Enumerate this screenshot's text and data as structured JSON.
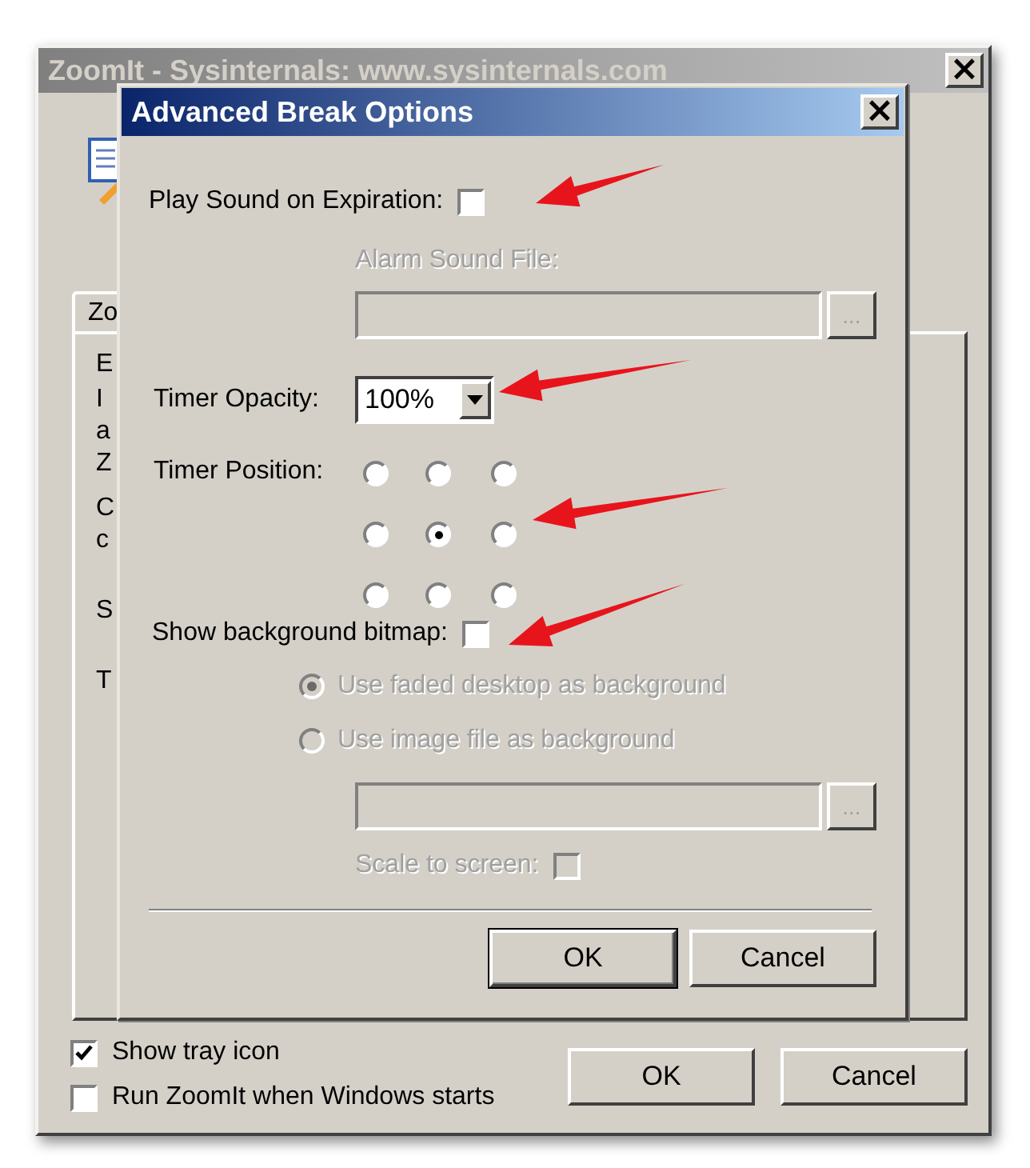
{
  "main_window": {
    "title": "ZoomIt - Sysinternals: www.sysinternals.com",
    "active": false,
    "close": "×",
    "tab": {
      "label": "Zo"
    },
    "hidden_text_fragments": [
      "E",
      "I",
      "a",
      "Z",
      "C",
      "c",
      "S",
      "T"
    ],
    "checkboxes": [
      {
        "label": "Show tray icon",
        "checked": true
      },
      {
        "label": "Run ZoomIt when Windows starts",
        "checked": false
      }
    ],
    "buttons": [
      {
        "label": "OK",
        "default": false
      },
      {
        "label": "Cancel",
        "default": false
      }
    ]
  },
  "dialog": {
    "title": "Advanced Break Options",
    "active": true,
    "close": "×",
    "play_sound": {
      "label": "Play Sound on Expiration:",
      "checked": false
    },
    "alarm_file": {
      "label": "Alarm Sound File:",
      "disabled": true,
      "browse": "..."
    },
    "opacity": {
      "label": "Timer Opacity:",
      "value": "100%"
    },
    "position": {
      "label": "Timer Position:",
      "options": [
        {
          "selected": false
        },
        {
          "selected": false
        },
        {
          "selected": false
        },
        {
          "selected": false
        },
        {
          "selected": true
        },
        {
          "selected": false
        },
        {
          "selected": false
        },
        {
          "selected": false
        },
        {
          "selected": false
        }
      ]
    },
    "background": {
      "label": "Show background bitmap:",
      "checked": false,
      "options": [
        {
          "label": "Use faded desktop as background",
          "selected": true,
          "disabled": true
        },
        {
          "label": "Use image file as background",
          "selected": false,
          "disabled": true
        }
      ],
      "file_disabled": true,
      "browse": "...",
      "scale": {
        "label": "Scale to screen:",
        "checked": false,
        "disabled": true
      }
    },
    "buttons": [
      {
        "label": "OK",
        "default": true
      },
      {
        "label": "Cancel",
        "default": false
      }
    ]
  },
  "annotations": [
    {
      "kind": "arrow"
    },
    {
      "kind": "arrow"
    },
    {
      "kind": "arrow"
    },
    {
      "kind": "arrow"
    }
  ]
}
